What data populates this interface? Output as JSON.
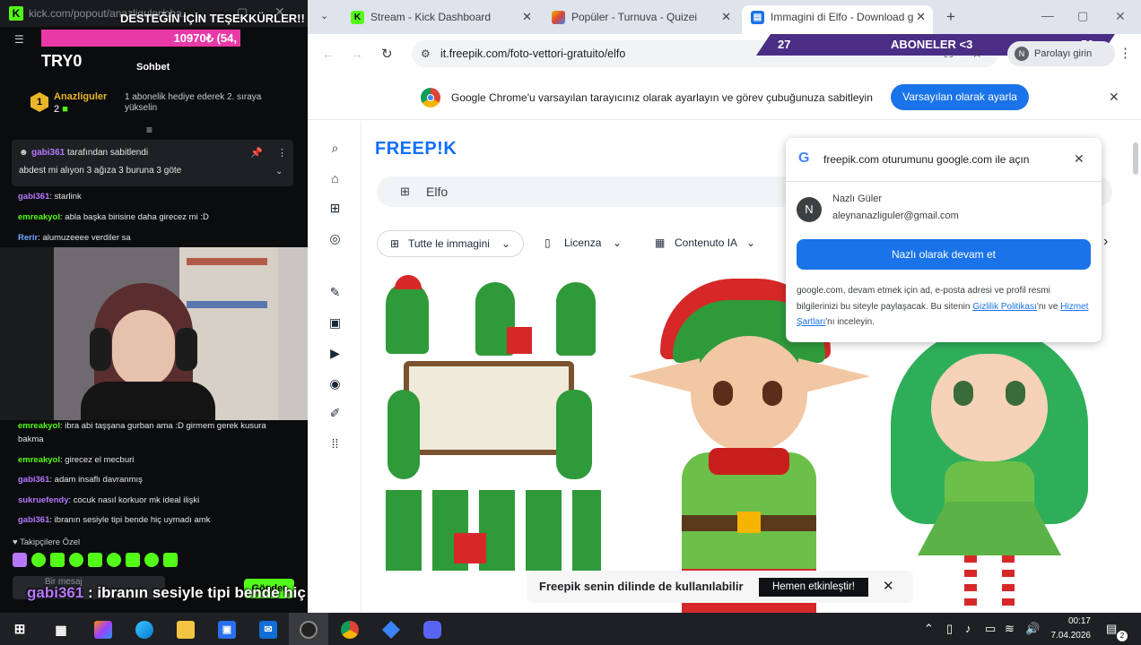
{
  "popout": {
    "url": "kick.com/popout/anazliguler/cha...",
    "thanks_banner": "DESTEĞİN İÇİN TEŞEKKÜRLER!!",
    "goal_text": "10970₺ (54,",
    "streamer": "TRY0",
    "tab_label": "Sohbet",
    "gifter": {
      "name": "Anazliguler",
      "count": "2",
      "rank": "1",
      "info": "1 abonelik hediye ederek 2. sıraya yükselin"
    },
    "pinned": {
      "by_user": "gabi361",
      "by_text": "tarafından sabitlendi",
      "text": "abdest mi alıyon 3 ağıza 3 buruna 3 göte"
    },
    "chat": [
      {
        "user": "gabi361",
        "text": ": starlink"
      },
      {
        "user": "emreakyol",
        "text": ": abla başka birisine daha girecez mi :D"
      },
      {
        "user": "Rerir",
        "text": ": alumuzeeee verdiler sa"
      },
      {
        "user": "emreakyol",
        "text": ": ibra abi taşşana gurban ama :D girmem gerek kusura"
      },
      {
        "user": "",
        "text": "bakma"
      },
      {
        "user": "emreakyol",
        "text": ": girecez el mecburi"
      },
      {
        "user": "gabi361",
        "text": ": adam insaflı davranmış"
      },
      {
        "user": "sukruefendy",
        "text": ": cocuk nasıl korkuor mk ideal ilişki"
      },
      {
        "user": "gabi361",
        "text": ": ibranın sesiyle tipi bende hiç uymadı amk"
      }
    ],
    "follower_label": "Takipçilere Özel",
    "input_placeholder": "Bir mesaj",
    "send_label": "Gönder",
    "ticker": {
      "user": "gabi361",
      "text": " : ibranın sesiyle tipi bende hiç uymadı amk"
    }
  },
  "tabs": [
    {
      "label": "Stream - Kick Dashboard"
    },
    {
      "label": "Popüler - Turnuva - Quizei"
    },
    {
      "label": "Immagini di Elfo - Download g"
    }
  ],
  "omnibox": {
    "url": "it.freepik.com/foto-vettori-gratuito/elfo",
    "profile_label": "Parolayı girin"
  },
  "sub_overlay": {
    "left": "27",
    "label": "ABONELER <3",
    "right": "50"
  },
  "infobar": {
    "text": "Google Chrome'u varsayılan tarayıcınız olarak ayarlayın ve görev çubuğunuza sabitleyin",
    "button": "Varsayılan olarak ayarla"
  },
  "freepik": {
    "logo": "FREEP!K",
    "search": "Elfo",
    "filters": [
      "Tutte le immagini",
      "Licenza",
      "Contenuto IA"
    ]
  },
  "gsi": {
    "title": "freepik.com oturumunu google.com ile açın",
    "name": "Nazlı Güler",
    "email": "aleynanazliguler@gmail.com",
    "avatar": "N",
    "continue": "Nazlı olarak devam et",
    "disclaimer_pre": "google.com, devam etmek için ad, e-posta adresi ve profil resmi bilgilerinizi bu siteyle paylaşacak. Bu sitenin ",
    "privacy": "Gizlilik Politikası",
    "mid": "'nı ve ",
    "terms": "Hizmet Şartları",
    "post": "'nı inceleyin."
  },
  "lang_toast": {
    "text": "Freepik senin dilinde de kullanılabilir",
    "button": "Hemen etkinleştir!"
  },
  "taskbar": {
    "time": "00:17",
    "date": "7.04.2026",
    "badge": "2"
  },
  "colors": {
    "kick_green": "#53fc18",
    "chrome_blue": "#1a73e8",
    "freepik_blue": "#0f6fff"
  }
}
